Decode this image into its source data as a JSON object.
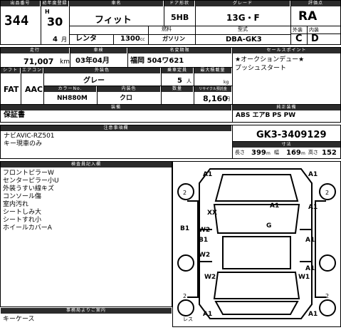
{
  "header": {
    "lot_label": "出品番号",
    "lot": "344",
    "reg_label": "初年度登録",
    "era": "H",
    "year": "30",
    "month": "4",
    "month_unit": "月",
    "car_label": "車名",
    "car_name": "フィット",
    "doors_label": "ドア形状",
    "doors": "5HB",
    "grade_label": "グレード",
    "grade": "13G・F",
    "use": "レンタ",
    "displacement": "1300",
    "cc": "cc",
    "fuel_label": "燃料",
    "fuel": "ガソリン",
    "model_label": "型式",
    "model": "DBA-GK3",
    "rating_label": "評価点",
    "rating": "RA",
    "ext_label": "外装",
    "ext": "C",
    "int_label": "内装",
    "int": "D"
  },
  "row2": {
    "mileage_label": "走行",
    "mileage": "71,007",
    "km": "km",
    "inspection_label": "車検",
    "inspection": "03年04月",
    "plate_label": "名変期限",
    "plate": "福岡 504ワ621",
    "sales_label": "セールスポイント",
    "sales": [
      "★オークションデュー★",
      "プッシュスタート"
    ],
    "shift_label": "シフト",
    "shift": "FAT",
    "ac_label": "エアコン",
    "ac": "AAC",
    "color_label": "外装色",
    "color": "グレー",
    "seats_label": "乗車定員",
    "seats": "5",
    "seats_unit": "人",
    "load_label": "最大積載量",
    "load_unit": "kg",
    "color_no_label": "カラーNo.",
    "color_no": "NH880M",
    "interior_label": "内装色",
    "interior": "クロ",
    "qty_label": "数量",
    "recycle_label": "リサイクル預託金",
    "recycle": "8,160",
    "yen": "円"
  },
  "equipment": {
    "label": "装備",
    "right_label": "純正装備",
    "warranty": "保証書",
    "std": "ABS エアB PS PW"
  },
  "notes": {
    "label": "注意事項欄",
    "lines": [
      "ナビAVIC-RZ501",
      "キー現車のみ"
    ],
    "frame_no": "GK3-3409129",
    "size_label": "寸法",
    "len_label": "長さ",
    "len": "399",
    "unit_m": "m",
    "wid_label": "幅",
    "wid": "169",
    "hei_label": "高さ",
    "hei": "152"
  },
  "inspector": {
    "label": "検査員記入欄",
    "lines": [
      "フロントピラーW",
      "センターピラー小U",
      "外装うすい線キズ",
      "コンソール傷",
      "室内汚れ",
      "シートしみ大",
      "シートすれ小",
      "ホイールカバーA"
    ]
  },
  "diagram": {
    "marks": [
      "A1",
      "A1",
      "A1",
      "A1",
      "XX",
      "G",
      "B1",
      "W2",
      "B1",
      "W2",
      "A1",
      "W2",
      "W1",
      "A1",
      "A1",
      "A1"
    ],
    "misc": [
      "2",
      "2",
      "2",
      "2",
      "レス"
    ]
  },
  "footer": {
    "label": "事務局よりご案内",
    "text": "キーケース"
  }
}
